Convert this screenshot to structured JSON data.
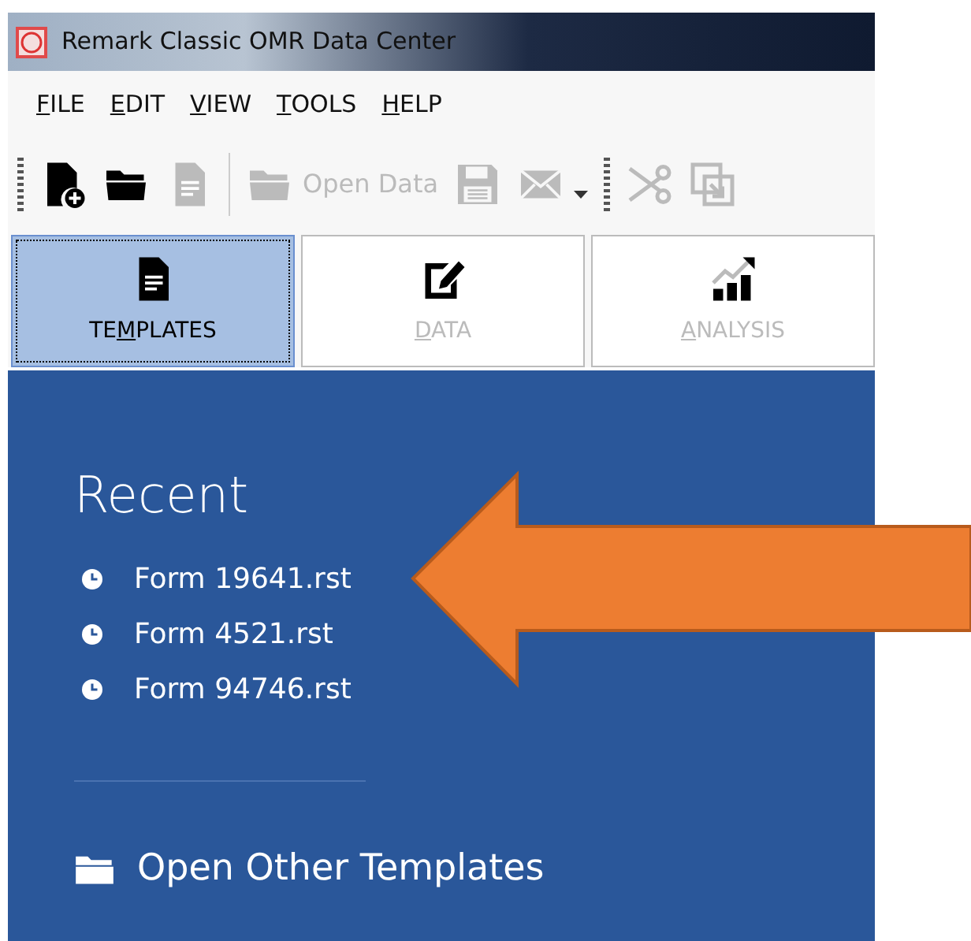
{
  "window": {
    "title": "Remark Classic OMR Data Center"
  },
  "menu": [
    {
      "key": "F",
      "post": "ILE"
    },
    {
      "key": "E",
      "post": "DIT"
    },
    {
      "key": "V",
      "post": "IEW"
    },
    {
      "key": "T",
      "post": "OOLS"
    },
    {
      "key": "H",
      "post": "ELP"
    }
  ],
  "toolbar": [
    {
      "kind": "grip"
    },
    {
      "kind": "icon",
      "disabled": false
    },
    {
      "kind": "icon",
      "disabled": false
    },
    {
      "kind": "icon",
      "disabled": true
    },
    {
      "kind": "separator"
    },
    {
      "kind": "button",
      "label": "Open Data",
      "disabled": true
    },
    {
      "kind": "icon",
      "disabled": true
    },
    {
      "kind": "icon",
      "disabled": true,
      "dropdown": true
    },
    {
      "kind": "grip"
    },
    {
      "kind": "icon",
      "disabled": true
    },
    {
      "kind": "icon",
      "disabled": true
    }
  ],
  "tabs": [
    {
      "pre": "TE",
      "key": "M",
      "post": "PLATES",
      "selected": true,
      "disabled": false
    },
    {
      "key": "D",
      "post": "ATA",
      "selected": false,
      "disabled": true
    },
    {
      "key": "A",
      "post": "NALYSIS",
      "selected": false,
      "disabled": true
    }
  ],
  "panel": {
    "heading": "Recent",
    "recent": [
      "Form 19641.rst",
      "Form 4521.rst",
      "Form 94746.rst"
    ],
    "open_other": "Open Other Templates"
  },
  "callout": {
    "kind": "arrow"
  }
}
